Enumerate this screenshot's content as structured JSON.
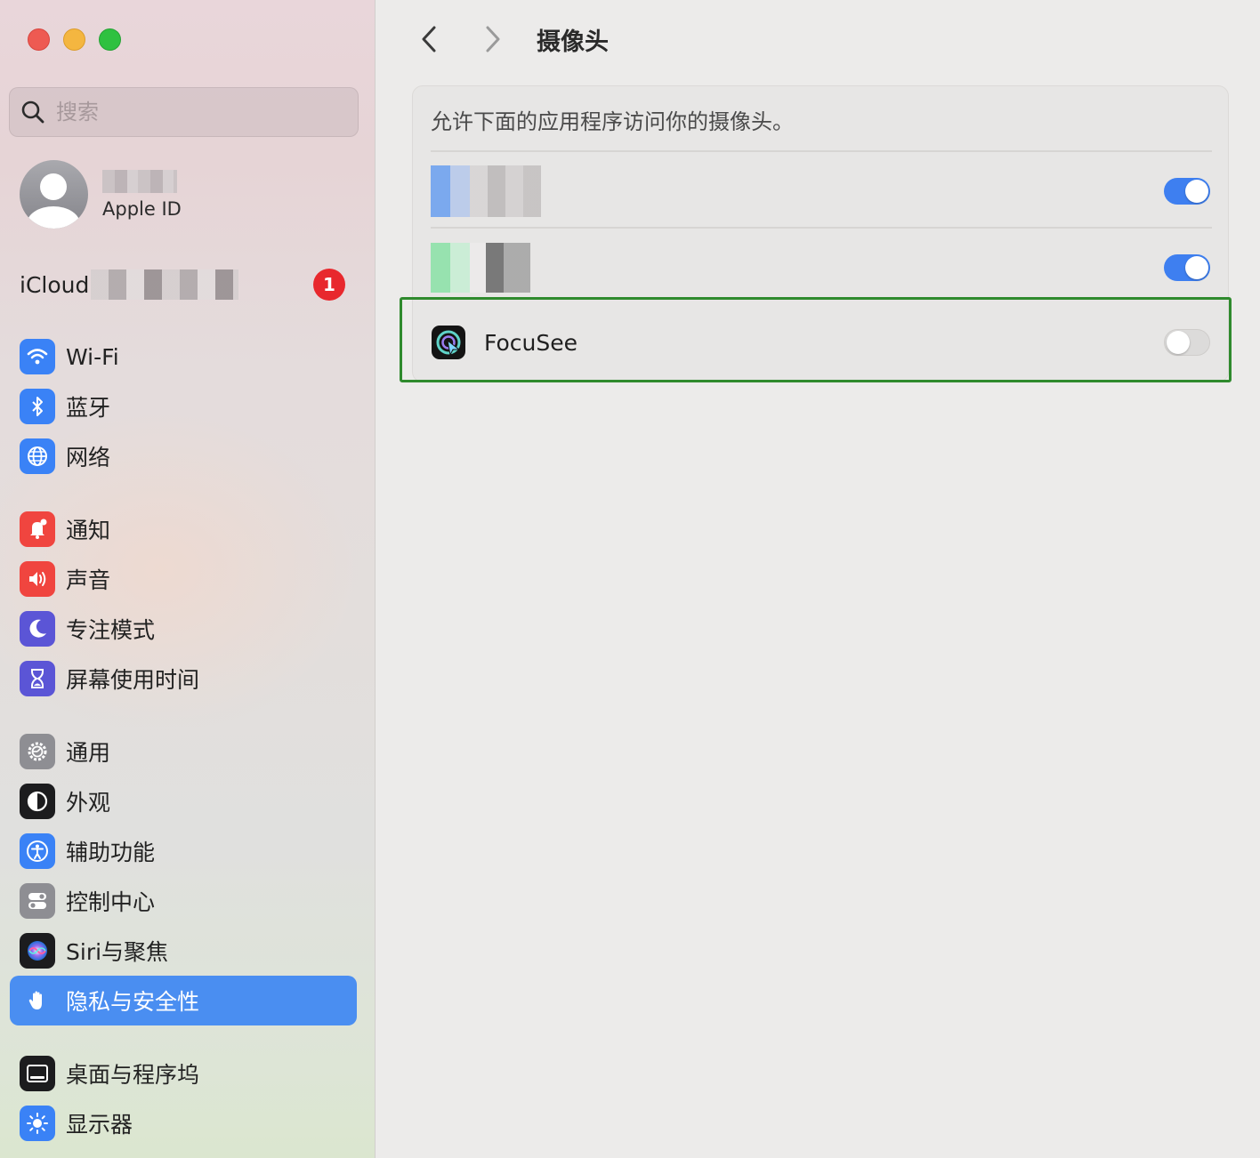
{
  "sidebar": {
    "search_placeholder": "搜索",
    "account_subtitle": "Apple ID",
    "icloud_label": "iCloud",
    "icloud_badge": "1",
    "groups": [
      [
        {
          "key": "wifi",
          "label": "Wi-Fi",
          "icon": "wifi-icon",
          "color": "#3a82f6"
        },
        {
          "key": "bluetooth",
          "label": "蓝牙",
          "icon": "bluetooth-icon",
          "color": "#3a82f6"
        },
        {
          "key": "network",
          "label": "网络",
          "icon": "globe-icon",
          "color": "#3a82f6"
        }
      ],
      [
        {
          "key": "notifications",
          "label": "通知",
          "icon": "bell-icon",
          "color": "#f0453f"
        },
        {
          "key": "sound",
          "label": "声音",
          "icon": "speaker-icon",
          "color": "#f0453f"
        },
        {
          "key": "focus",
          "label": "专注模式",
          "icon": "moon-icon",
          "color": "#5b55d6"
        },
        {
          "key": "screen-time",
          "label": "屏幕使用时间",
          "icon": "hourglass-icon",
          "color": "#5b55d6"
        }
      ],
      [
        {
          "key": "general",
          "label": "通用",
          "icon": "gear-icon",
          "color": "#8e8e93"
        },
        {
          "key": "appearance",
          "label": "外观",
          "icon": "appearance-icon",
          "color": "#1c1c1e"
        },
        {
          "key": "accessibility",
          "label": "辅助功能",
          "icon": "accessibility-icon",
          "color": "#3a82f6"
        },
        {
          "key": "control-center",
          "label": "控制中心",
          "icon": "toggles-icon",
          "color": "#8e8e93"
        },
        {
          "key": "siri",
          "label": "Siri与聚焦",
          "icon": "siri-icon",
          "color": "#1c1c1e"
        },
        {
          "key": "privacy",
          "label": "隐私与安全性",
          "icon": "hand-icon",
          "color": "#3a82f6",
          "selected": true
        }
      ],
      [
        {
          "key": "desktop-dock",
          "label": "桌面与程序坞",
          "icon": "dock-icon",
          "color": "#1c1c1e"
        },
        {
          "key": "displays",
          "label": "显示器",
          "icon": "sun-icon",
          "color": "#3a82f6"
        }
      ]
    ]
  },
  "main": {
    "title": "摄像头",
    "description": "允许下面的应用程序访问你的摄像头。",
    "apps": [
      {
        "name": "",
        "enabled": true,
        "blurred": true
      },
      {
        "name": "",
        "enabled": true,
        "blurred": true
      },
      {
        "name": "FocuSee",
        "enabled": false,
        "blurred": false
      }
    ]
  },
  "colors": {
    "accent": "#4a8ef1",
    "toggle_on": "#3e7ff0",
    "highlight": "#2f8a2d",
    "badge": "#e8282d"
  }
}
